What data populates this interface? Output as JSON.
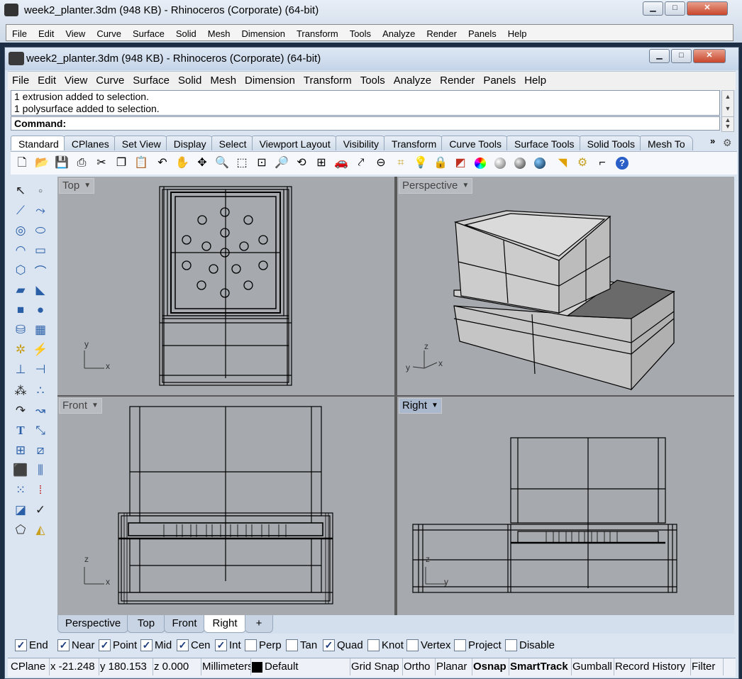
{
  "background_window": {
    "title": "week2_planter.3dm (948 KB) - Rhinoceros (Corporate) (64-bit)",
    "menu": [
      "File",
      "Edit",
      "View",
      "Curve",
      "Surface",
      "Solid",
      "Mesh",
      "Dimension",
      "Transform",
      "Tools",
      "Analyze",
      "Render",
      "Panels",
      "Help"
    ]
  },
  "window": {
    "title": "week2_planter.3dm (948 KB) - Rhinoceros (Corporate) (64-bit)",
    "controls": {
      "minimize": "▁",
      "maximize": "□",
      "close": "✕"
    }
  },
  "menu": [
    "File",
    "Edit",
    "View",
    "Curve",
    "Surface",
    "Solid",
    "Mesh",
    "Dimension",
    "Transform",
    "Tools",
    "Analyze",
    "Render",
    "Panels",
    "Help"
  ],
  "command_history": [
    "1 extrusion added to selection.",
    "1 polysurface added to selection."
  ],
  "command_prompt": "Command:",
  "toolbar_tabs": [
    "Standard",
    "CPlanes",
    "Set View",
    "Display",
    "Select",
    "Viewport Layout",
    "Visibility",
    "Transform",
    "Curve Tools",
    "Surface Tools",
    "Solid Tools",
    "Mesh To"
  ],
  "toolbar_more": "»",
  "viewports": {
    "top": "Top",
    "perspective": "Perspective",
    "front": "Front",
    "right": "Right",
    "axes": {
      "x": "x",
      "y": "y",
      "z": "z"
    }
  },
  "viewport_tabs": [
    "Perspective",
    "Top",
    "Front",
    "Right",
    "+"
  ],
  "osnap": [
    {
      "label": "End",
      "checked": true
    },
    {
      "label": "Near",
      "checked": true
    },
    {
      "label": "Point",
      "checked": true
    },
    {
      "label": "Mid",
      "checked": true
    },
    {
      "label": "Cen",
      "checked": true
    },
    {
      "label": "Int",
      "checked": true
    },
    {
      "label": "Perp",
      "checked": false
    },
    {
      "label": "Tan",
      "checked": false
    },
    {
      "label": "Quad",
      "checked": true
    },
    {
      "label": "Knot",
      "checked": false
    },
    {
      "label": "Vertex",
      "checked": false
    },
    {
      "label": "Project",
      "checked": false
    },
    {
      "label": "Disable",
      "checked": false
    }
  ],
  "status": {
    "cplane": "CPlane",
    "x": "x -21.248",
    "y": "y 180.153",
    "z": "z 0.000",
    "units": "Millimeters",
    "layer": "Default",
    "grid_snap": "Grid Snap",
    "ortho": "Ortho",
    "planar": "Planar",
    "osnap": "Osnap",
    "smarttrack": "SmartTrack",
    "gumball": "Gumball",
    "record_history": "Record History",
    "filter": "Filter"
  }
}
